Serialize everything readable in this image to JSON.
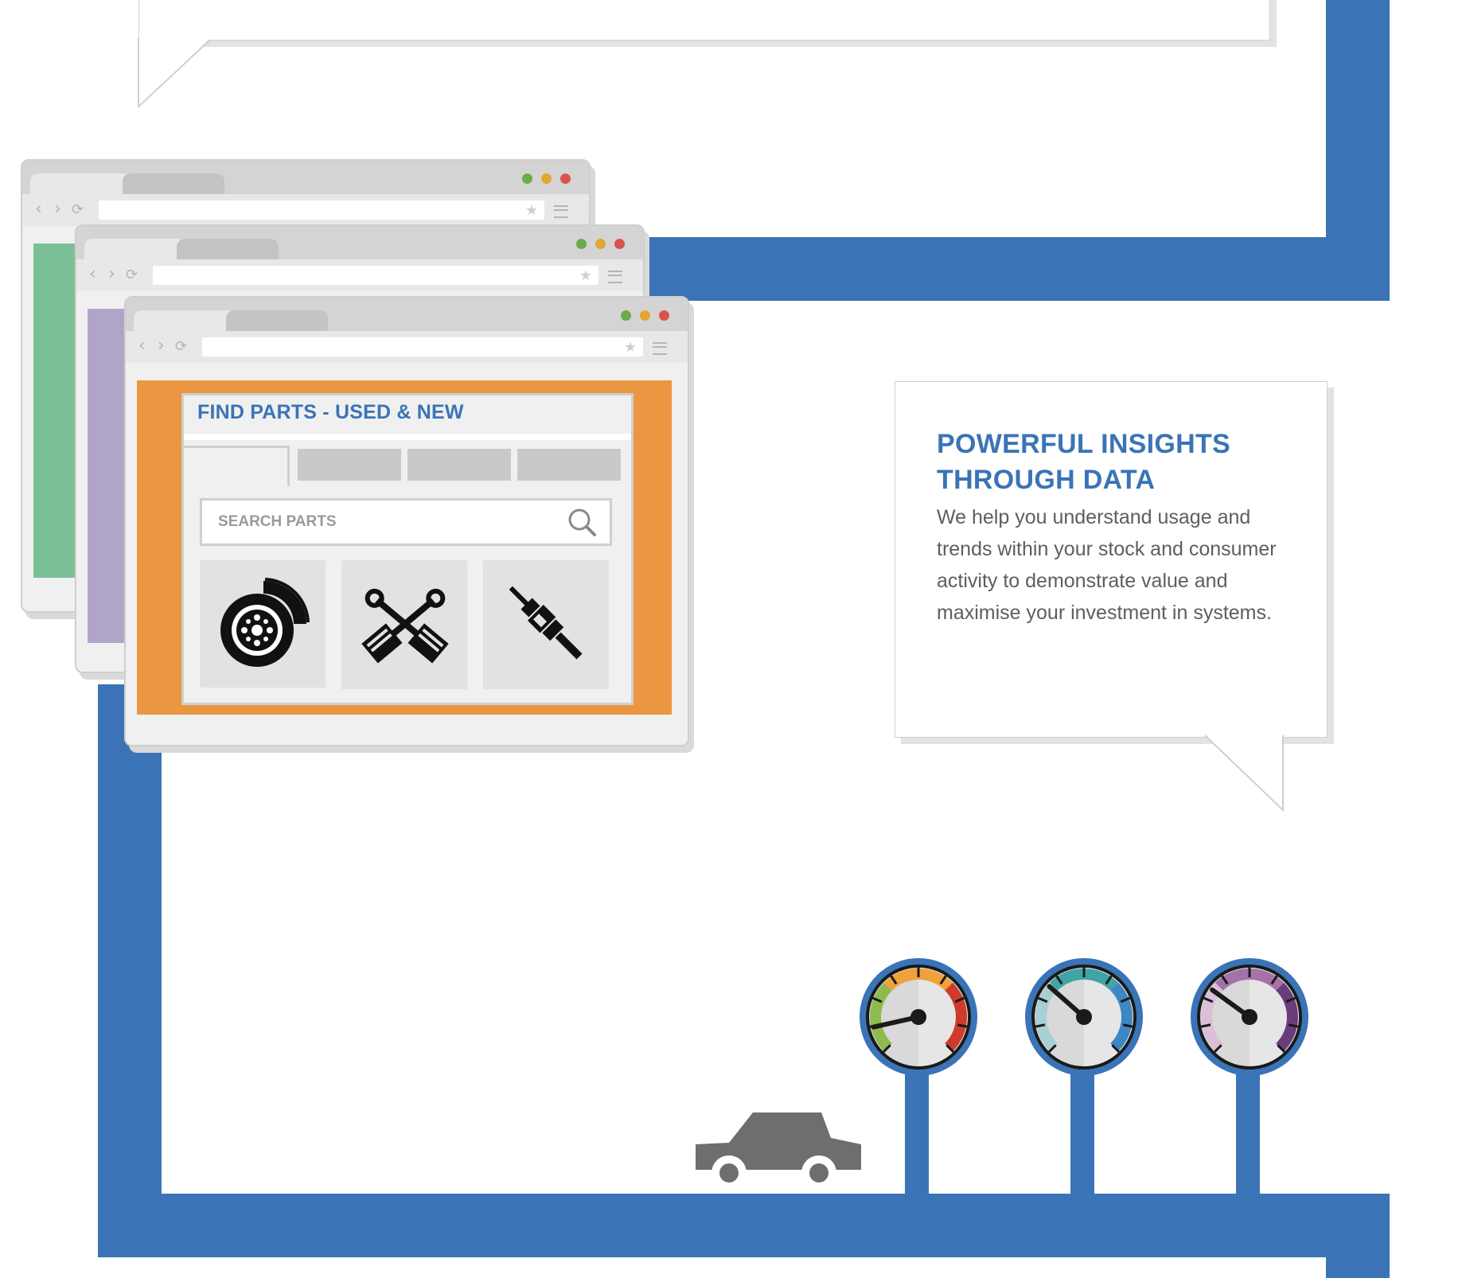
{
  "browser": {
    "nav": {
      "back_glyph": "‹",
      "forward_glyph": "›",
      "reload_glyph": "⟳",
      "bookmark_glyph": "★"
    },
    "window_dots": {
      "green": "#6cab4b",
      "yellow": "#e2a634",
      "red": "#d9534f"
    }
  },
  "parts_finder": {
    "title": "FIND PARTS - USED & NEW",
    "search_placeholder": "SEARCH PARTS",
    "icons": [
      "brake-disc-icon",
      "pistons-icon",
      "spark-plug-icon"
    ]
  },
  "insights": {
    "heading": "POWERFUL INSIGHTS THROUGH DATA",
    "body": "We help you understand usage and trends within your stock and consumer activity to demonstrate value and maximise your investment in systems."
  },
  "colors": {
    "accent_blue": "#3a74b6",
    "panel_orange": "#eb9741",
    "panel_green": "#7cc098",
    "panel_purple": "#b0a4c8",
    "heading_blue": "#3a74b6",
    "car_gray": "#6d6e70"
  },
  "gauges": [
    {
      "name": "gauge-multicolor",
      "arc_colors": [
        "#8fba4d",
        "#f0a13a",
        "#d03a2c"
      ],
      "needle_level": 0.12
    },
    {
      "name": "gauge-teal",
      "arc_colors": [
        "#a8cfd4",
        "#3fa3a7",
        "#3c87c4"
      ],
      "needle_level": 0.32
    },
    {
      "name": "gauge-purple",
      "arc_colors": [
        "#dbbfd8",
        "#a472a8",
        "#6a3c7c"
      ],
      "needle_level": 0.3
    }
  ]
}
